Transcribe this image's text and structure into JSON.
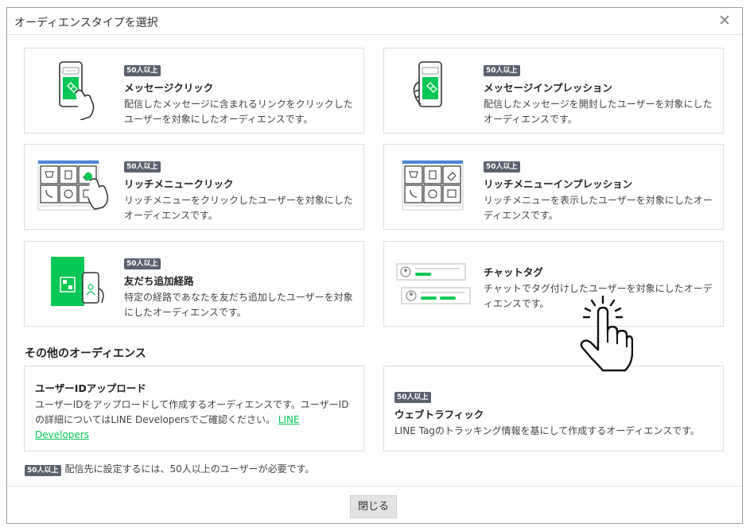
{
  "modal": {
    "title": "オーディエンスタイプを選択",
    "close_icon": "close-icon"
  },
  "badge_label": "50人以上",
  "cards": [
    {
      "id": "message-click",
      "badge": "50人以上",
      "title": "メッセージクリック",
      "desc": "配信したメッセージに含まれるリンクをクリックしたユーザーを対象にしたオーディエンスです。"
    },
    {
      "id": "message-impression",
      "badge": "50人以上",
      "title": "メッセージインプレッション",
      "desc": "配信したメッセージを開封したユーザーを対象にしたオーディエンスです。"
    },
    {
      "id": "richmenu-click",
      "badge": "50人以上",
      "title": "リッチメニュークリック",
      "desc": "リッチメニューをクリックしたユーザーを対象にしたオーディエンスです。"
    },
    {
      "id": "richmenu-impression",
      "badge": "50人以上",
      "title": "リッチメニューインプレッション",
      "desc": "リッチメニューを表示したユーザーを対象にしたオーディエンスです。"
    },
    {
      "id": "friend-route",
      "badge": "50人以上",
      "title": "友だち追加経路",
      "desc": "特定の経路であなたを友だち追加したユーザーを対象にしたオーディエンスです。"
    },
    {
      "id": "chat-tag",
      "title": "チャットタグ",
      "desc": "チャットでタグ付けしたユーザーを対象にしたオーディエンスです。"
    }
  ],
  "other_section": {
    "title": "その他のオーディエンス",
    "upload": {
      "title": "ユーザーIDアップロード",
      "desc": "ユーザーIDをアップロードして作成するオーディエンスです。ユーザーIDの詳細についてはLINE Developersでご確認ください。",
      "link": "LINE Developers"
    },
    "web_traffic": {
      "badge": "50人以上",
      "title": "ウェブトラフィック",
      "desc": "LINE Tagのトラッキング情報を基にして作成するオーディエンスです。"
    }
  },
  "footnote": {
    "badge": "50人以上",
    "text": "配信先に設定するには、50人以上のユーザーが必要です。"
  },
  "footer": {
    "close_label": "閉じる"
  },
  "icons": {
    "phone": "phone-tap-icon",
    "richmenu": "richmenu-grid-icon",
    "qr": "qr-phone-icon",
    "chat": "chat-tag-icon",
    "hand": "pointer-hand-icon"
  },
  "colors": {
    "accent": "#06c755",
    "badge_bg": "#5c6170",
    "border": "#dedede"
  }
}
